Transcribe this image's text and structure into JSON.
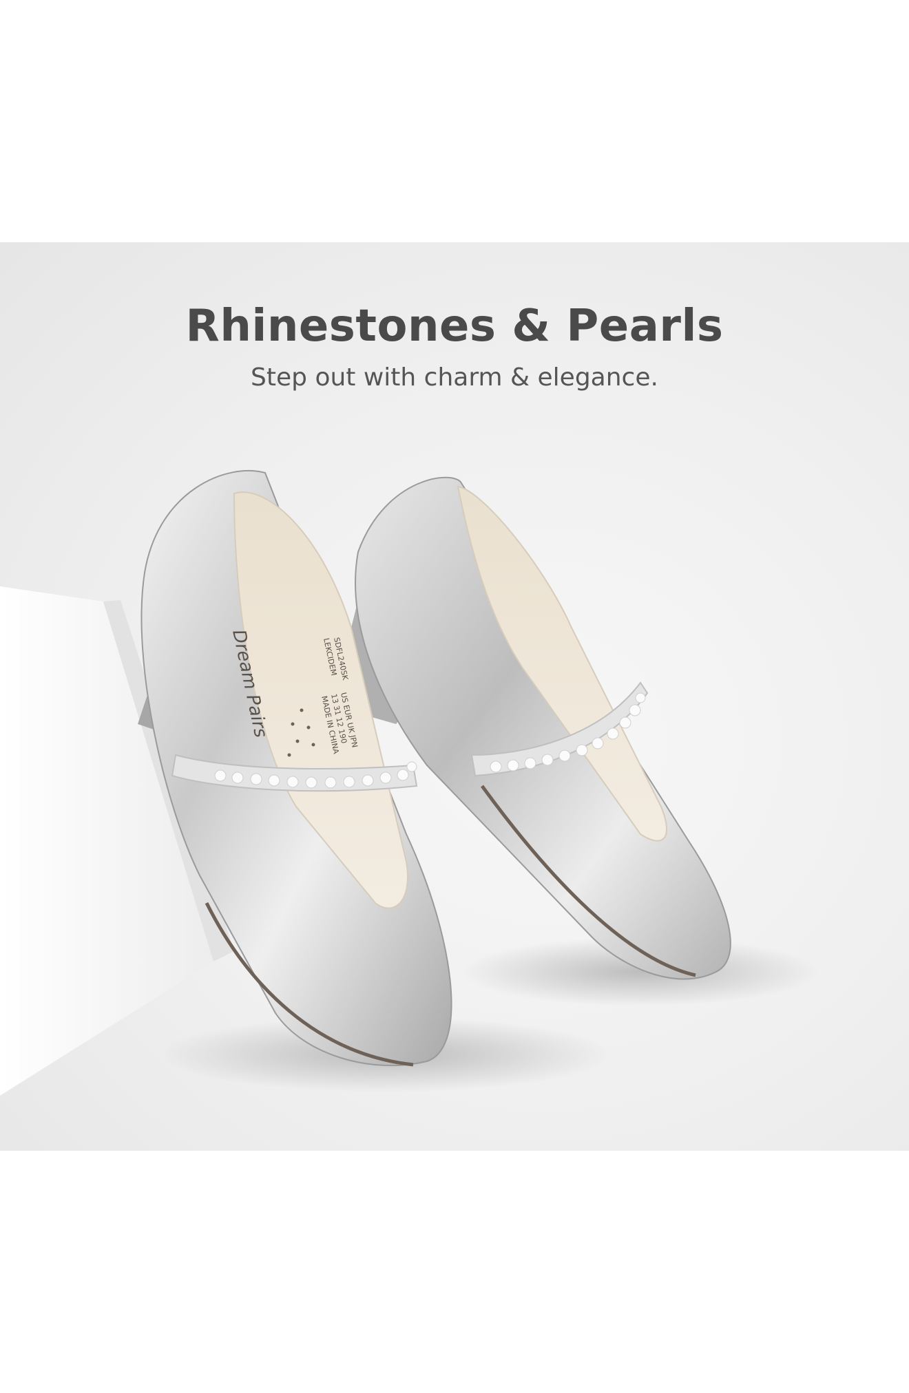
{
  "banner": {
    "title": "Rhinestones & Pearls",
    "subtitle": "Step out with charm & elegance."
  },
  "insole_print": {
    "brand_logo_text": "Dream Pairs",
    "line1": "SDFL240SK",
    "line2": "LEKCIDEM",
    "size_header": "US EUR UK JPN",
    "size_values": "13 31 12 190",
    "origin": "MADE IN CHINA"
  },
  "colors": {
    "panel_background": "#efefef",
    "headline_text": "#4a4a4a",
    "shoe_silver": "#d9d9d9",
    "insole_cream": "#efe6d8",
    "pedestal_white": "#f9f9f9"
  }
}
